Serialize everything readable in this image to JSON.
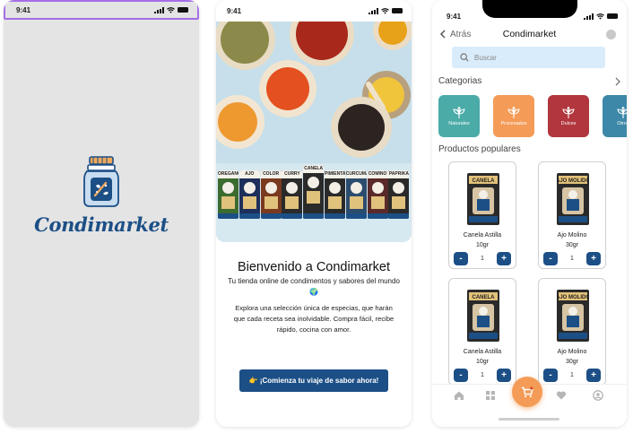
{
  "status": {
    "time": "9:41"
  },
  "splash": {
    "brand": "Condimarket"
  },
  "welcome": {
    "title": "Bienvenido a Condimarket",
    "subtitle": "Tu tienda online de condimentos y sabores del mundo 🌍",
    "body": "Explora una selección única de especias, que harán que cada receta sea inolvidable. Compra fácil, recibe rápido, cocina con amor.",
    "cta_label": "👉 ¡Comienza tu viaje de sabor ahora!",
    "packet_labels": [
      "OREGANO",
      "AJO",
      "COLOR",
      "CURRY",
      "CANELA",
      "PIMIENTA",
      "CURCUMA",
      "COMINO",
      "PAPRIKA"
    ]
  },
  "market": {
    "back_label": "Atrás",
    "title": "Condimarket",
    "search_placeholder": "Buscar",
    "categories_title": "Categorias",
    "categories": [
      {
        "label": "Naturales",
        "color": "#4aaba7"
      },
      {
        "label": "Procesados",
        "color": "#f49b57"
      },
      {
        "label": "Dulces",
        "color": "#b1363d"
      },
      {
        "label": "Otros",
        "color": "#3d88a8"
      }
    ],
    "popular_title": "Productos populares",
    "products": [
      {
        "name": "Canela Astilla",
        "weight": "10gr",
        "qty": "1",
        "pack": "CANELA"
      },
      {
        "name": "Ajo Molino",
        "weight": "30gr",
        "qty": "1",
        "pack": "AJO MOLIDO"
      },
      {
        "name": "Canela Astilla",
        "weight": "10gr",
        "qty": "1",
        "pack": "CANELA"
      },
      {
        "name": "Ajo Molino",
        "weight": "30gr",
        "qty": "1",
        "pack": "AJO MOLIDO"
      }
    ],
    "minus": "-",
    "plus": "+"
  },
  "colors": {
    "brand_blue": "#1c4f86",
    "accent_orange": "#f49b57",
    "search_bg": "#d9ecfb",
    "highlight": "#a46ee8"
  }
}
